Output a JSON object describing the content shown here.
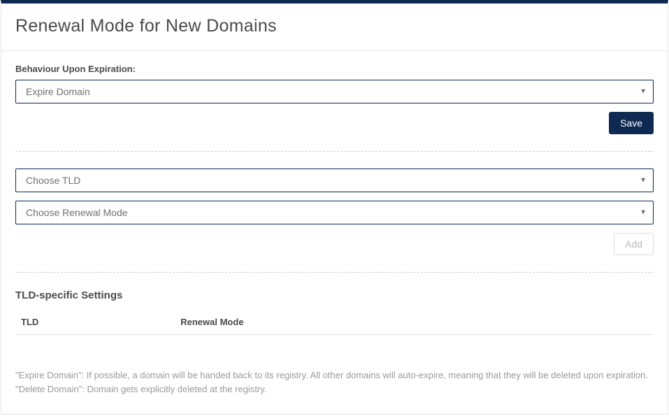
{
  "header": {
    "title": "Renewal Mode for New Domains"
  },
  "behaviour": {
    "label": "Behaviour Upon Expiration:",
    "selected": "Expire Domain",
    "save_label": "Save"
  },
  "add_section": {
    "tld_placeholder": "Choose TLD",
    "mode_placeholder": "Choose Renewal Mode",
    "add_label": "Add"
  },
  "table": {
    "heading": "TLD-specific Settings",
    "columns": {
      "tld": "TLD",
      "renewal_mode": "Renewal Mode"
    }
  },
  "help": {
    "text": "\"Expire Domain\": If possible, a domain will be handed back to its registry. All other domains will auto-expire, meaning that they will be deleted upon expiration. \"Delete Domain\": Domain gets explicitly deleted at the registry."
  }
}
